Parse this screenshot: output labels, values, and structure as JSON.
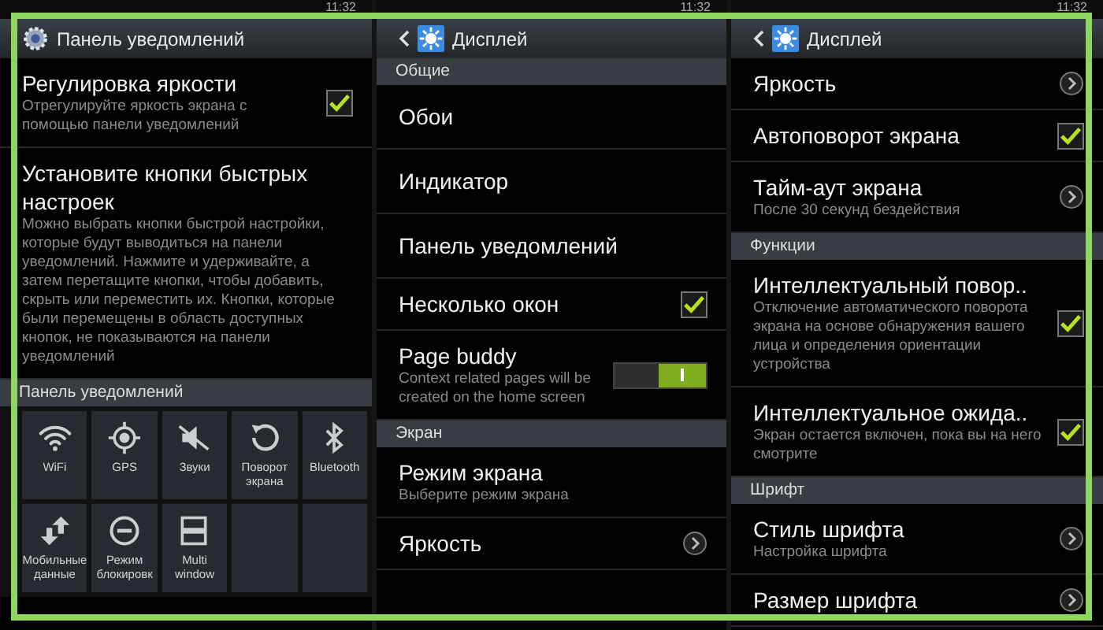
{
  "panels": [
    {
      "status_time": "11:32",
      "title": "Панель уведомлений",
      "back": false,
      "kind": "gear",
      "items": [
        {
          "kind": "check",
          "title": "Регулировка яркости",
          "subtitle": "Отрегулируйте яркость экрана с помощью панели уведомлений",
          "checked": true
        },
        {
          "kind": "plain",
          "title": "Установите кнопки быстрых настроек",
          "subtitle": "Можно выбрать кнопки быстрой настройки, которые будут выводиться на панели уведомлений. Нажмите и удерживайте, а затем перетащите кнопки, чтобы добавить, скрыть или переместить их. Кнопки, которые были перемещены в область доступных кнопок, не показываются на панели уведомлений"
        },
        {
          "kind": "header",
          "title": "Панель уведомлений"
        },
        {
          "kind": "tiles",
          "tiles": [
            {
              "kind": "wifi",
              "label": "WiFi"
            },
            {
              "kind": "gps",
              "label": "GPS"
            },
            {
              "kind": "sound",
              "label": "Звуки"
            },
            {
              "kind": "rotate",
              "label": "Поворот экрана"
            },
            {
              "kind": "bluetooth",
              "label": "Bluetooth"
            },
            {
              "kind": "data",
              "label": "Мобильные данные"
            },
            {
              "kind": "block",
              "label": "Режим блокировк"
            },
            {
              "kind": "multiwindow",
              "label": "Multi window"
            },
            {
              "kind": "empty"
            },
            {
              "kind": "empty"
            }
          ]
        }
      ]
    },
    {
      "status_time": "11:32",
      "title": "Дисплей",
      "back": true,
      "kind": "display",
      "items": [
        {
          "kind": "header",
          "title": "Общие"
        },
        {
          "kind": "plain",
          "title": "Обои"
        },
        {
          "kind": "plain",
          "title": "Индикатор"
        },
        {
          "kind": "plain",
          "title": "Панель уведомлений"
        },
        {
          "kind": "check",
          "title": "Несколько окон",
          "checked": true
        },
        {
          "kind": "toggle",
          "title": "Page buddy",
          "subtitle": "Context related pages will be created on the home screen",
          "on": true
        },
        {
          "kind": "header",
          "title": "Экран"
        },
        {
          "kind": "plain",
          "title": "Режим экрана",
          "subtitle": "Выберите режим экрана"
        },
        {
          "kind": "link",
          "title": "Яркость"
        }
      ]
    },
    {
      "status_time": "11:32",
      "title": "Дисплей",
      "back": true,
      "kind": "display",
      "items": [
        {
          "kind": "link",
          "title": "Яркость"
        },
        {
          "kind": "check",
          "title": "Автоповорот экрана",
          "checked": true
        },
        {
          "kind": "link",
          "title": "Тайм-аут экрана",
          "subtitle": "После 30 секунд бездействия"
        },
        {
          "kind": "header",
          "title": "Функции"
        },
        {
          "kind": "check",
          "title": "Интеллектуальный повор..",
          "subtitle": "Отключение автоматического поворота экрана на основе обнаружения вашего лица и определения ориентации устройства",
          "checked": true
        },
        {
          "kind": "check",
          "title": "Интеллектуальное ожида..",
          "subtitle": "Экран остается включен, пока вы на него смотрите",
          "checked": true
        },
        {
          "kind": "header",
          "title": "Шрифт"
        },
        {
          "kind": "link",
          "title": "Стиль шрифта",
          "subtitle": "Настройка шрифта"
        },
        {
          "kind": "link",
          "title": "Размер шрифта"
        }
      ]
    }
  ]
}
